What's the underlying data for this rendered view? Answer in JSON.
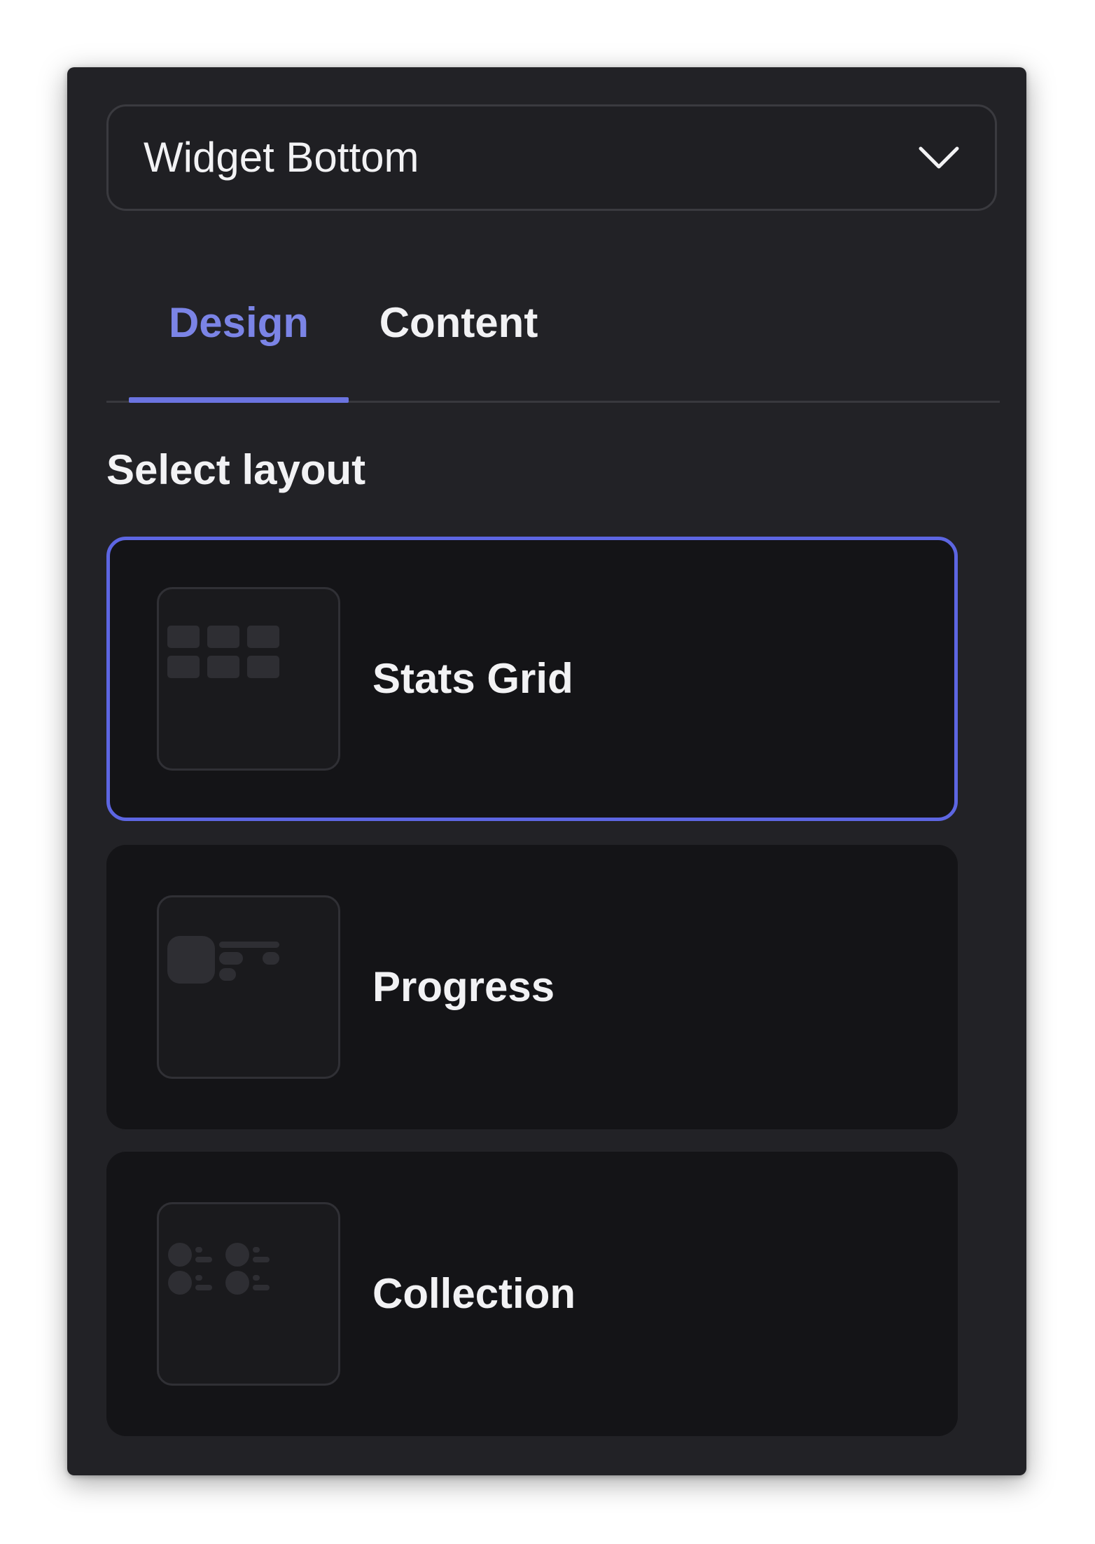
{
  "dropdown": {
    "value": "Widget Bottom",
    "icon": "chevron-down-icon"
  },
  "tabs": [
    {
      "label": "Design",
      "active": true
    },
    {
      "label": "Content",
      "active": false
    }
  ],
  "section": {
    "title": "Select layout"
  },
  "layouts": [
    {
      "label": "Stats Grid",
      "selected": true,
      "icon": "stats-grid-thumbnail-icon"
    },
    {
      "label": "Progress",
      "selected": false,
      "icon": "progress-thumbnail-icon"
    },
    {
      "label": "Collection",
      "selected": false,
      "icon": "collection-thumbnail-icon"
    }
  ],
  "colors": {
    "panel_bg": "#222226",
    "card_bg": "#141417",
    "accent": "#6b74e0",
    "active_tab_text": "#7b84e6",
    "text": "#f2f2f4",
    "thumb_shape": "#2e2e33"
  }
}
